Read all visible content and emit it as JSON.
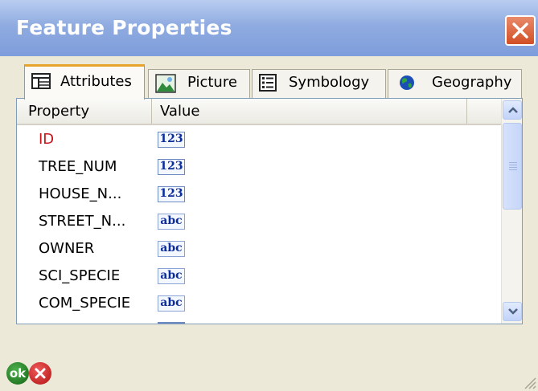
{
  "window": {
    "title": "Feature Properties"
  },
  "tabs": [
    {
      "label": "Attributes",
      "icon": "table-icon",
      "active": true
    },
    {
      "label": "Picture",
      "icon": "picture-icon",
      "active": false
    },
    {
      "label": "Symbology",
      "icon": "list-icon",
      "active": false
    },
    {
      "label": "Geography",
      "icon": "globe-icon",
      "active": false
    }
  ],
  "table": {
    "columns": [
      "Property",
      "Value"
    ],
    "rows": [
      {
        "property": "ID",
        "type": "123",
        "highlighted": true
      },
      {
        "property": "TREE_NUM",
        "type": "123"
      },
      {
        "property": "HOUSE_N...",
        "type": "123"
      },
      {
        "property": "STREET_N...",
        "type": "abc"
      },
      {
        "property": "OWNER",
        "type": "abc"
      },
      {
        "property": "SCI_SPECIE",
        "type": "abc"
      },
      {
        "property": "COM_SPECIE",
        "type": "abc"
      }
    ]
  },
  "buttons": {
    "ok": "ok"
  },
  "colors": {
    "titlebar": "#8fabe0",
    "highlight_text": "#c3161c",
    "close": "#d24f25"
  }
}
